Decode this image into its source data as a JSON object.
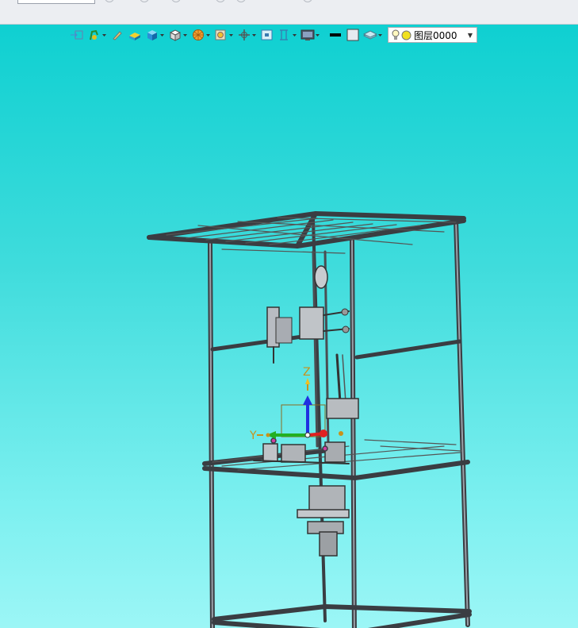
{
  "layer_select": {
    "value": "图层0000"
  },
  "triad": {
    "y_label": "Y",
    "z_label": "Z"
  },
  "colors": {
    "viewport_top": "#0fd0d1",
    "viewport_bottom": "#9cf6f6",
    "frame": "#3a3d42",
    "axis_x": "#e02020",
    "axis_y": "#22b022",
    "axis_z": "#2030e0",
    "axis_label": "#c8921a"
  },
  "toolbar_icons": [
    "exit-sketch-icon",
    "hook-tool-icon",
    "pencil-icon",
    "solid-box-icon",
    "box-shaded-icon",
    "cube-wire-icon",
    "sphere-icon",
    "zoom-icon",
    "pan-icon",
    "fit-view-icon",
    "section-icon",
    "display-mode-icon",
    "line-color-icon",
    "fill-color-icon",
    "layer-icon"
  ]
}
